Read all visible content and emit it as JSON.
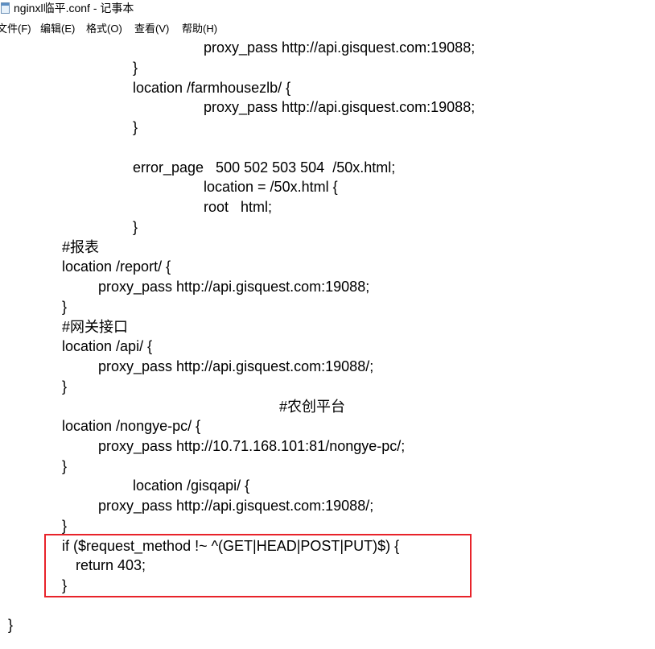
{
  "window": {
    "title": "nginxl临平.conf - 记事本",
    "icon": "notepad-icon"
  },
  "menubar": {
    "items": [
      {
        "label": "文件(F)"
      },
      {
        "label": "编辑(E)"
      },
      {
        "label": "格式(O)"
      },
      {
        "label": "查看(V)"
      },
      {
        "label": "帮助(H)"
      }
    ]
  },
  "editor": {
    "lines": [
      "proxy_pass http://api.gisquest.com:19088;",
      "}",
      "location /farmhousezlb/ {",
      "proxy_pass http://api.gisquest.com:19088;",
      "}",
      "error_page   500 502 503 504  /50x.html;",
      "location = /50x.html {",
      "root   html;",
      "}",
      "#报表",
      "location /report/ {",
      "proxy_pass http://api.gisquest.com:19088;",
      "}",
      "#网关接口",
      "location /api/ {",
      "proxy_pass http://api.gisquest.com:19088/;",
      "}",
      "#农创平台",
      "location /nongye-pc/ {",
      "proxy_pass http://10.71.168.101:81/nongye-pc/;",
      "}",
      "location /gisqapi/ {",
      "proxy_pass http://api.gisquest.com:19088/;",
      "}",
      "if ($request_method !~ ^(GET|HEAD|POST|PUT)$) {",
      "return 403;",
      "}",
      "}"
    ]
  },
  "highlight": {
    "color": "#e8232a"
  }
}
